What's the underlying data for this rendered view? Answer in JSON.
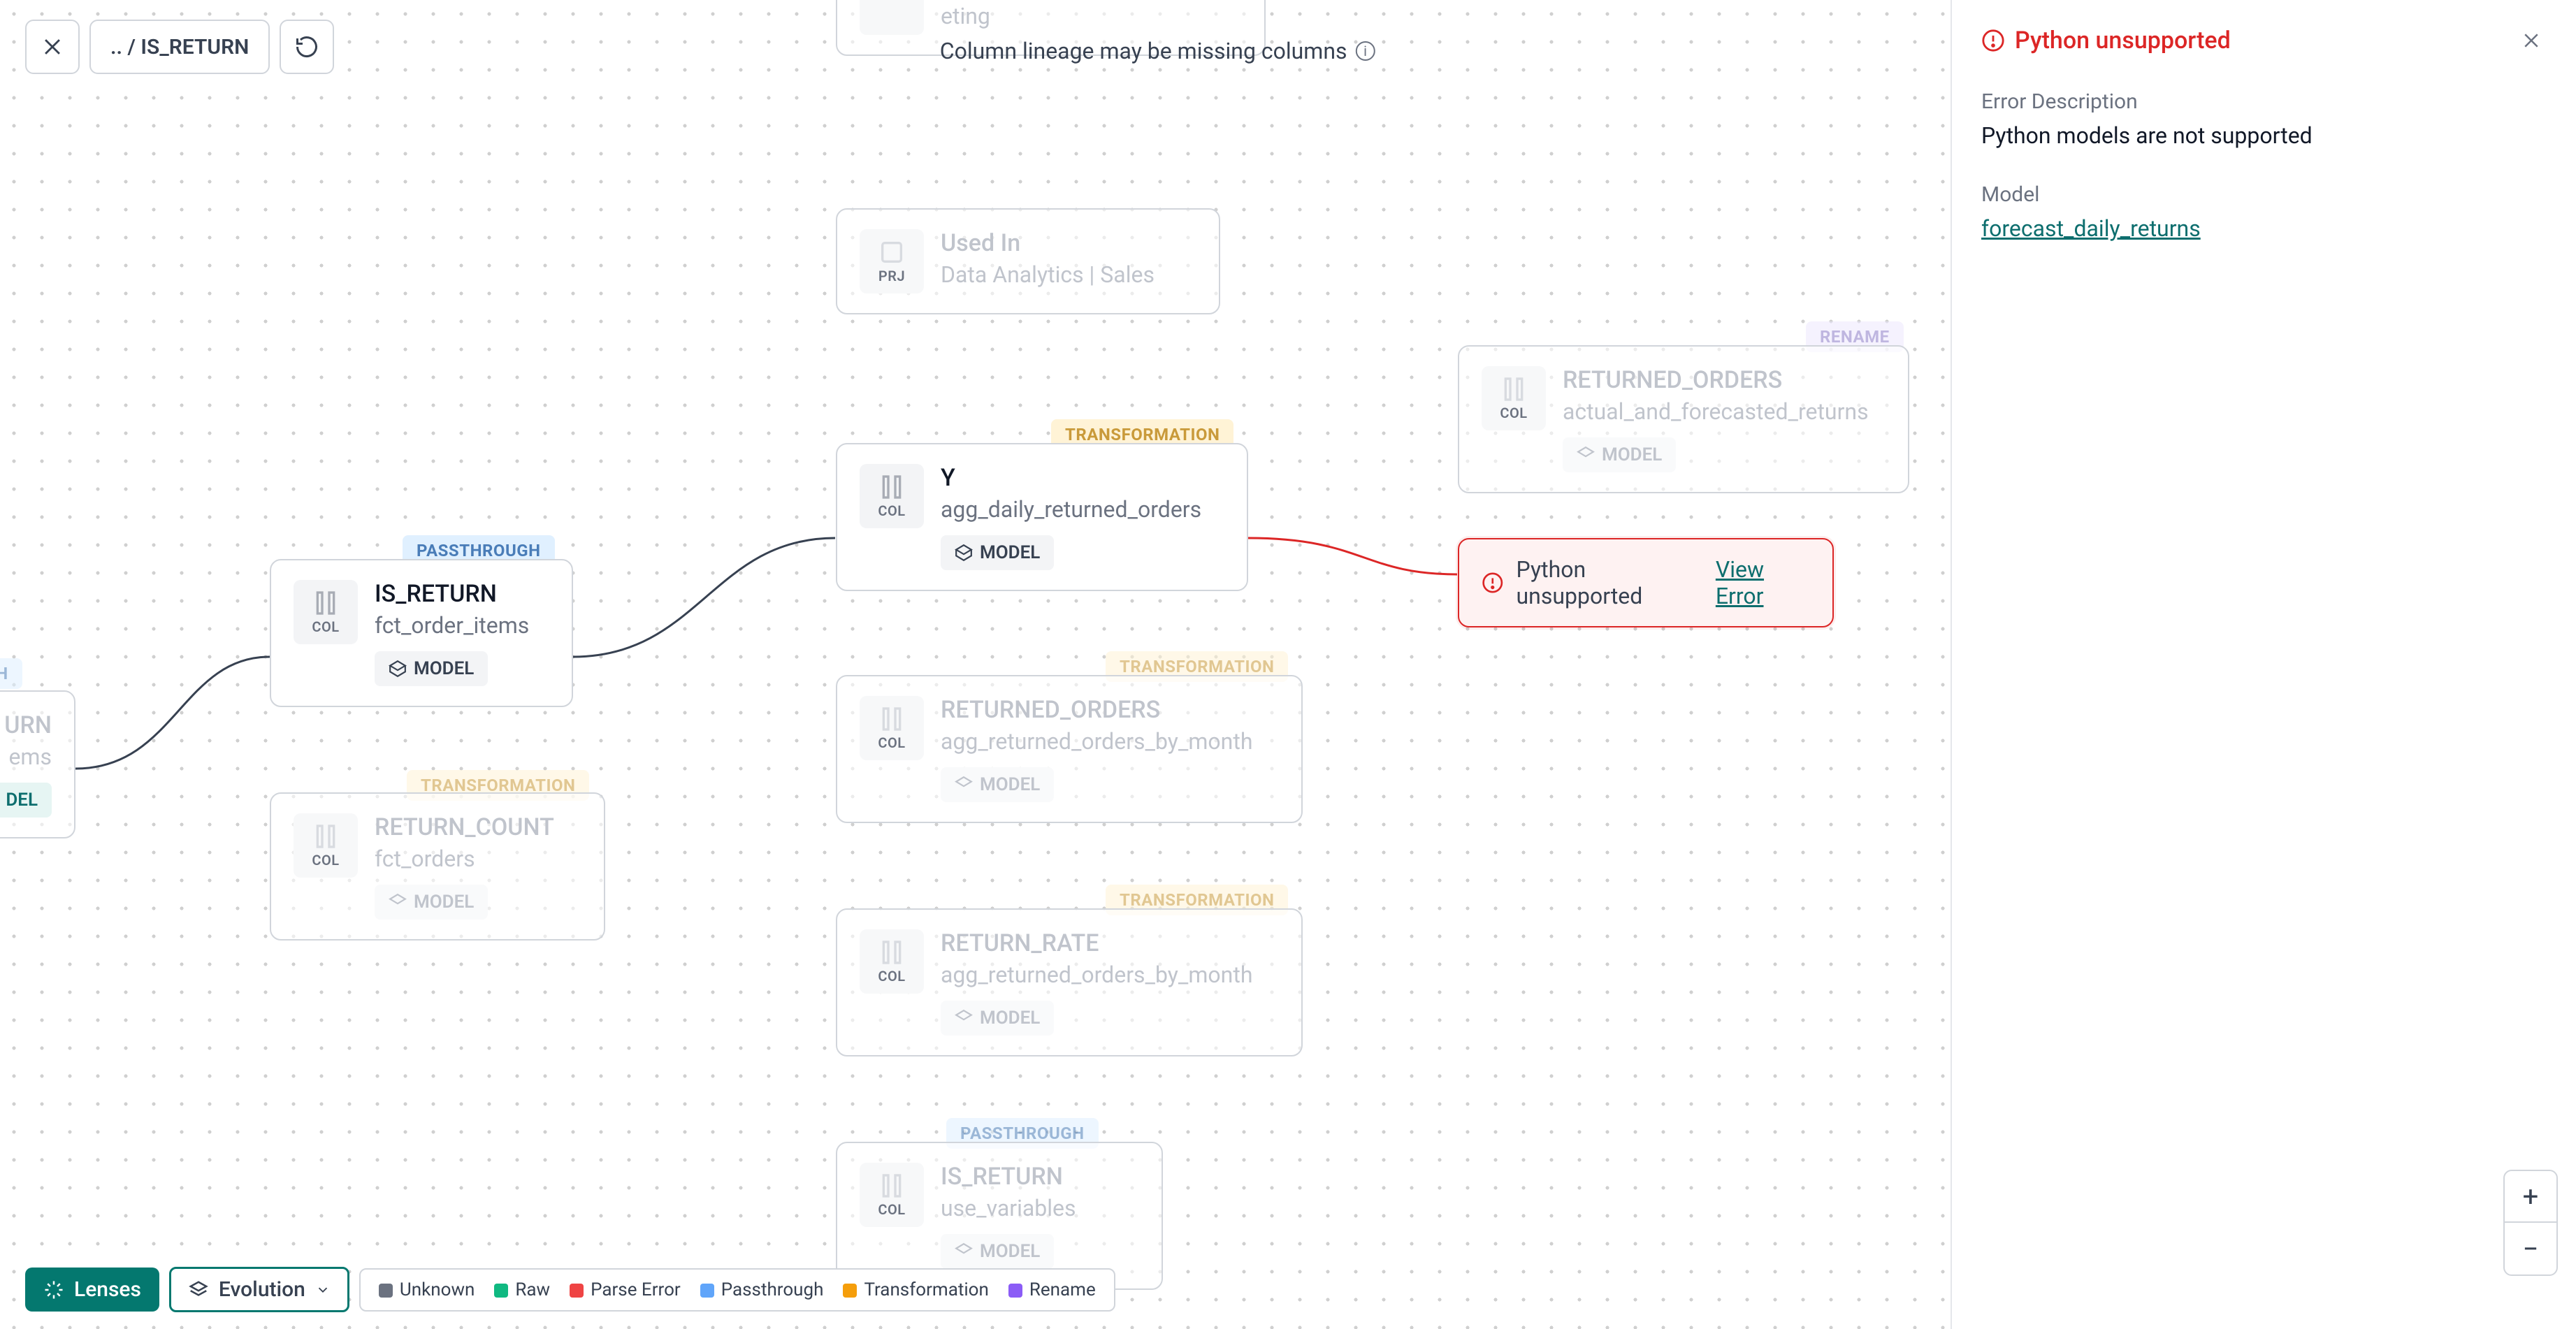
{
  "topbar": {
    "breadcrumb": ".. / IS_RETURN"
  },
  "notice": "Column lineage may be missing columns",
  "sidepanel": {
    "title": "Python unsupported",
    "desc_label": "Error Description",
    "desc_text": "Python models are not supported",
    "model_label": "Model",
    "model_link": "forecast_daily_returns"
  },
  "badges": {
    "passthrough": "PASSTHROUGH",
    "transformation": "TRANSFORMATION",
    "rename": "RENAME"
  },
  "common": {
    "col": "COL",
    "prj": "PRJ",
    "model": "MODEL",
    "del": "DEL",
    "ough": "OUGH"
  },
  "nodes": {
    "marketing": "eting",
    "usedin_label": "Used In",
    "usedin_sub": "Data Analytics | Sales",
    "is_return_title": "IS_RETURN",
    "is_return_sub": "fct_order_items",
    "y_title": "Y",
    "y_sub": "agg_daily_returned_orders",
    "ret_orders_title": "RETURNED_ORDERS",
    "ret_orders_sub": "actual_and_forecasted_returns",
    "ret_count_title": "RETURN_COUNT",
    "ret_count_sub": "fct_orders",
    "ret_orders2_title": "RETURNED_ORDERS",
    "ret_orders2_sub": "agg_returned_orders_by_month",
    "ret_rate_title": "RETURN_RATE",
    "ret_rate_sub": "agg_returned_orders_by_month",
    "is_return2_title": "IS_RETURN",
    "is_return2_sub": "use_variables",
    "urn": "URN",
    "ems": "ems"
  },
  "error_node": {
    "text": "Python unsupported",
    "link": "View Error"
  },
  "bottombar": {
    "lenses": "Lenses",
    "evolution": "Evolution",
    "legend": {
      "unknown": "Unknown",
      "raw": "Raw",
      "parse_error": "Parse Error",
      "passthrough": "Passthrough",
      "transformation": "Transformation",
      "rename": "Rename"
    }
  },
  "colors": {
    "unknown": "#6b7280",
    "raw": "#10b981",
    "parse_error": "#ef4444",
    "passthrough": "#60a5fa",
    "transformation": "#f59e0b",
    "rename": "#8b5cf6"
  }
}
